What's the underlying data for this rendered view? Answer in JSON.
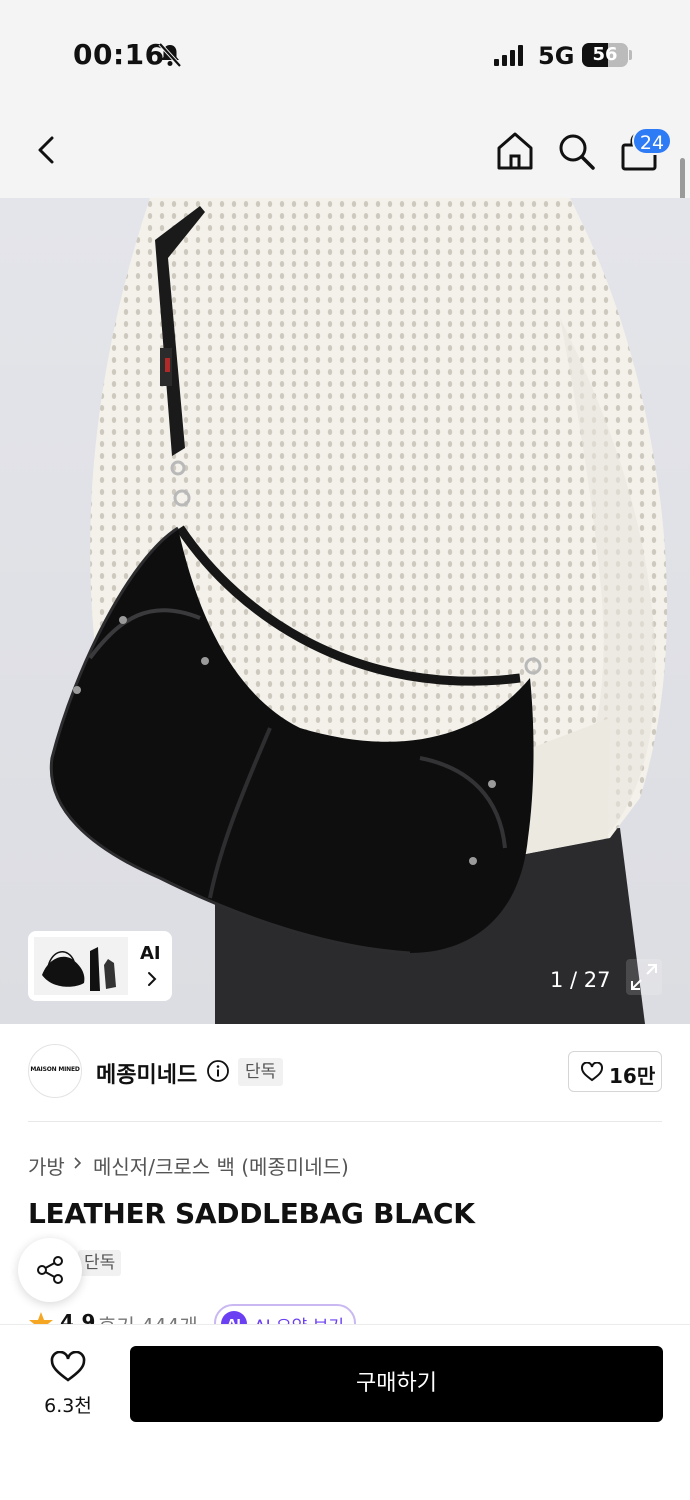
{
  "status_bar": {
    "time": "00:16",
    "network": "5G",
    "battery": "56",
    "battery_level": 0.56
  },
  "nav": {
    "cart_count": "24"
  },
  "gallery": {
    "ai_label": "AI",
    "counter": "1 / 27"
  },
  "brand": {
    "logo_text": "MAISON MINED",
    "name": "메종미네드",
    "exclusive": "단독",
    "like_count": "16만"
  },
  "breadcrumb": {
    "category": "가방",
    "subcategory": "메신저/크로스 백 (메종미네드)"
  },
  "product": {
    "title": "LEATHER SADDLEBAG BLACK",
    "exclusive": "단독",
    "rating": "4.9",
    "reviews": "후기 444개",
    "ai_summary": "AI 요약 보기",
    "ai_badge": "AI"
  },
  "bottom_bar": {
    "wish_count": "6.3천",
    "buy_label": "구매하기"
  },
  "colors": {
    "accent_blue": "#2e7bf6",
    "ai_purple": "#6b3ff2",
    "star": "#f5a623"
  },
  "icons": [
    "bell-slash-icon",
    "signal-icon",
    "back-icon",
    "home-icon",
    "search-icon",
    "shopping-bag-icon",
    "chevron-right-icon",
    "expand-icon",
    "info-icon",
    "heart-icon",
    "share-icon",
    "star-icon"
  ]
}
